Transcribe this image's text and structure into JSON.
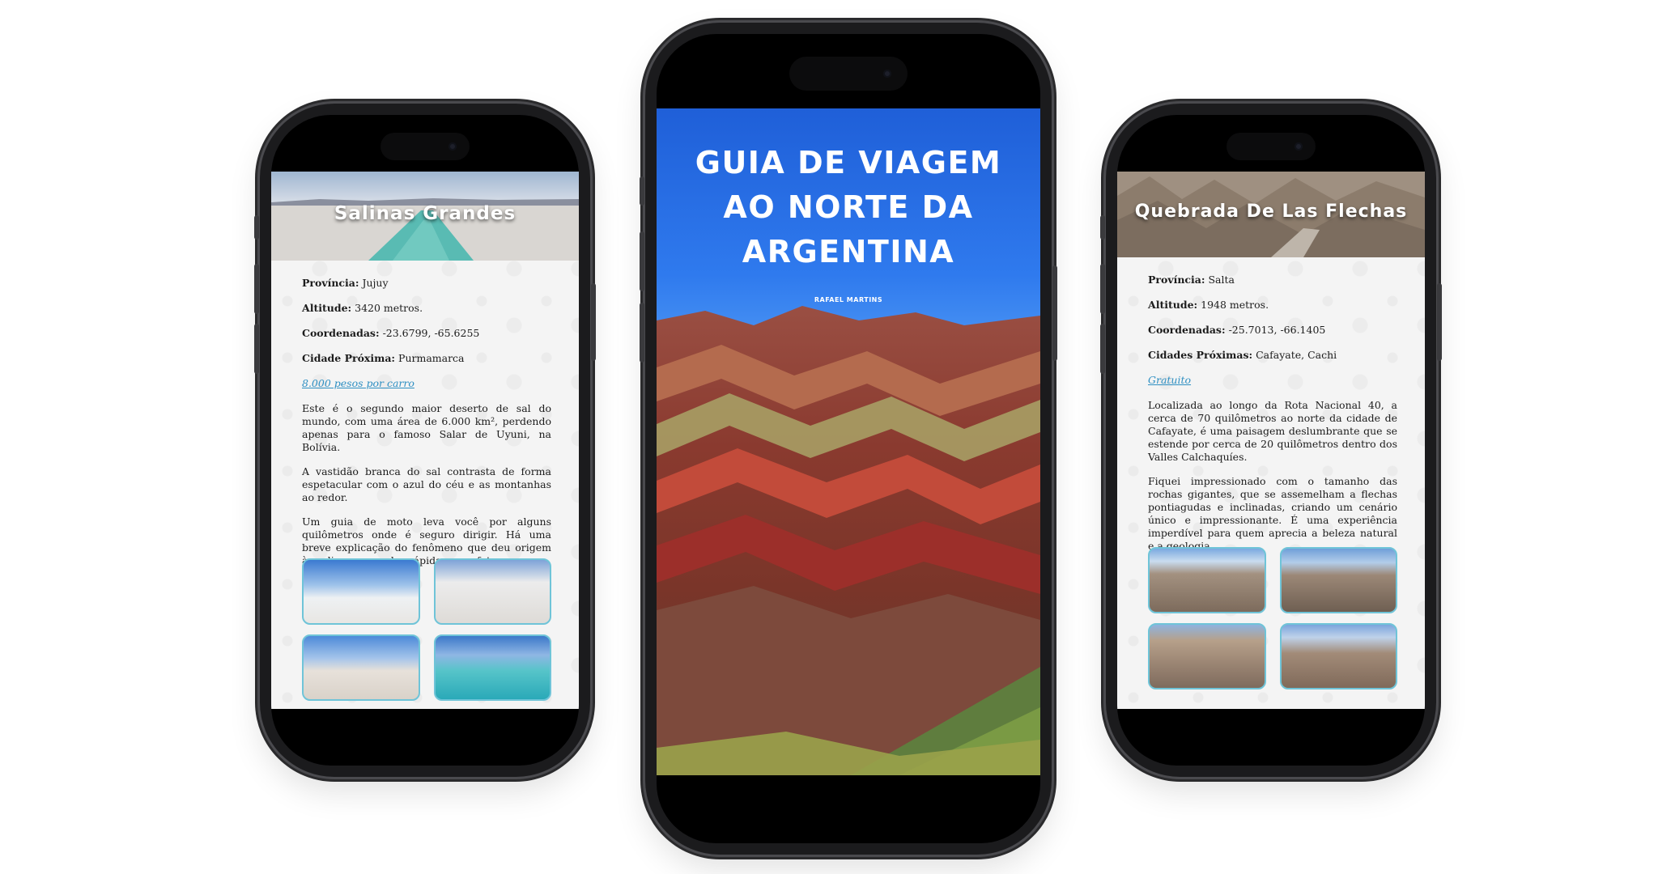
{
  "left_phone": {
    "hero_title": "Salinas Grandes",
    "fields": [
      {
        "label": "Província:",
        "value": "Jujuy"
      },
      {
        "label": "Altitude:",
        "value": "3420 metros."
      },
      {
        "label": "Coordenadas:",
        "value": "-23.6799, -65.6255"
      },
      {
        "label": "Cidade Próxima:",
        "value": "Purmamarca"
      }
    ],
    "price_link": "8.000 pesos por carro",
    "paragraphs": [
      "Este é o segundo maior deserto de sal do mundo, com uma área de 6.000 km², perdendo apenas para o famoso Salar de Uyuni, na Bolívia.",
      "A vastidão branca do sal contrasta de forma espetacular com o azul do céu e as montanhas ao redor.",
      "Um guia de moto leva você por alguns quilômetros onde é seguro dirigir. Há uma breve explicação do fenômeno que deu origem às salinas e paradas rápidas para fotos."
    ]
  },
  "center_phone": {
    "cover_title_line1": "GUIA DE VIAGEM",
    "cover_title_line2": "AO NORTE DA",
    "cover_title_line3": "ARGENTINA",
    "author": "RAFAEL MARTINS"
  },
  "right_phone": {
    "hero_title": "Quebrada De Las Flechas",
    "fields": [
      {
        "label": "Província:",
        "value": "Salta"
      },
      {
        "label": "Altitude:",
        "value": "1948 metros."
      },
      {
        "label": "Coordenadas:",
        "value": "-25.7013, -66.1405"
      },
      {
        "label": "Cidades Próximas:",
        "value": "Cafayate, Cachi"
      }
    ],
    "price_link": "Gratuito",
    "paragraphs": [
      "Localizada ao longo da Rota Nacional 40, a cerca de 70 quilômetros ao norte da cidade de Cafayate, é uma paisagem deslumbrante que se estende por cerca de 20 quilômetros dentro dos Valles Calchaquíes.",
      "Fiquei impressionado com o tamanho das rochas gigantes, que se assemelham a flechas pontiagudas e inclinadas, criando um cenário único e impressionante. É uma experiência imperdível para quem aprecia a beleza natural e a geologia."
    ]
  },
  "colors": {
    "link": "#2e8fc2",
    "thumb_border": "#6fc4d8",
    "phone_body": "#1b1b1d"
  }
}
